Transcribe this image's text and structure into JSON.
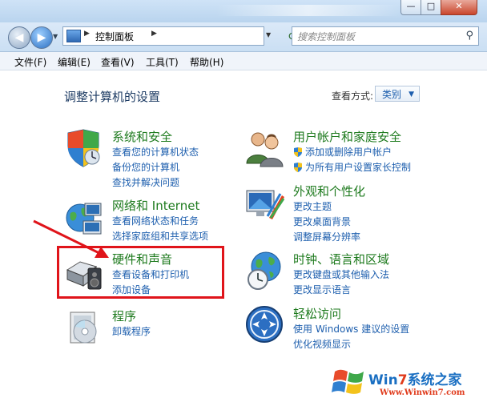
{
  "address": {
    "path_label": "控制面板",
    "search_placeholder": "搜索控制面板"
  },
  "menu": [
    "文件(F)",
    "编辑(E)",
    "查看(V)",
    "工具(T)",
    "帮助(H)"
  ],
  "content": {
    "heading": "调整计算机的设置",
    "view_by_label": "查看方式:",
    "view_by_value": "类别"
  },
  "categories": [
    {
      "title": "系统和安全",
      "links": [
        "查看您的计算机状态",
        "备份您的计算机",
        "查找并解决问题"
      ]
    },
    {
      "title": "网络和 Internet",
      "links": [
        "查看网络状态和任务",
        "选择家庭组和共享选项"
      ]
    },
    {
      "title": "硬件和声音",
      "links": [
        "查看设备和打印机",
        "添加设备"
      ]
    },
    {
      "title": "程序",
      "links": [
        "卸载程序"
      ]
    },
    {
      "title": "用户帐户和家庭安全",
      "links": [
        "添加或删除用户帐户",
        "为所有用户设置家长控制"
      ]
    },
    {
      "title": "外观和个性化",
      "links": [
        "更改主题",
        "更改桌面背景",
        "调整屏幕分辨率"
      ]
    },
    {
      "title": "时钟、语言和区域",
      "links": [
        "更改键盘或其他输入法",
        "更改显示语言"
      ]
    },
    {
      "title": "轻松访问",
      "links": [
        "使用 Windows 建议的设置",
        "优化视频显示"
      ]
    }
  ],
  "watermark": {
    "brand_prefix": "Win",
    "brand_seven": "7",
    "brand_suffix": "系统之家",
    "url": "Www.Winwin7.com"
  },
  "colors": {
    "category_title": "#1d7a1d",
    "link": "#1e5fae",
    "highlight_box": "#e0141a",
    "annotation_arrow": "#e0141a"
  }
}
